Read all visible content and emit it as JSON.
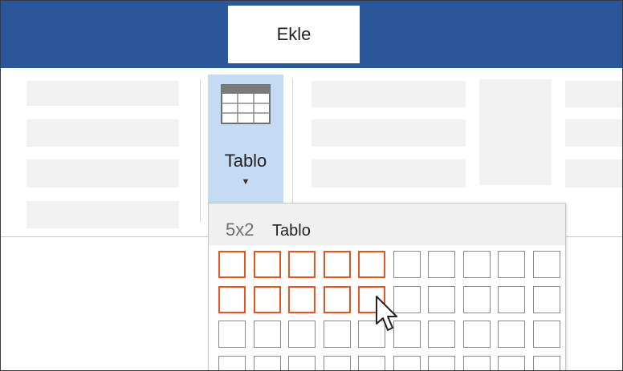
{
  "tab": {
    "label": "Ekle"
  },
  "tablo_button": {
    "label": "Tablo",
    "icon": "table-icon",
    "caret": "dropdown-caret-icon"
  },
  "table_picker": {
    "size_label": "5x2",
    "label": "Tablo",
    "columns": 10,
    "visible_rows": 4,
    "selected_columns": 5,
    "selected_rows": 2
  },
  "colors": {
    "title_bar": "#2b579a",
    "button_highlight": "#c5daf3",
    "selection_border": "#e8531f"
  }
}
